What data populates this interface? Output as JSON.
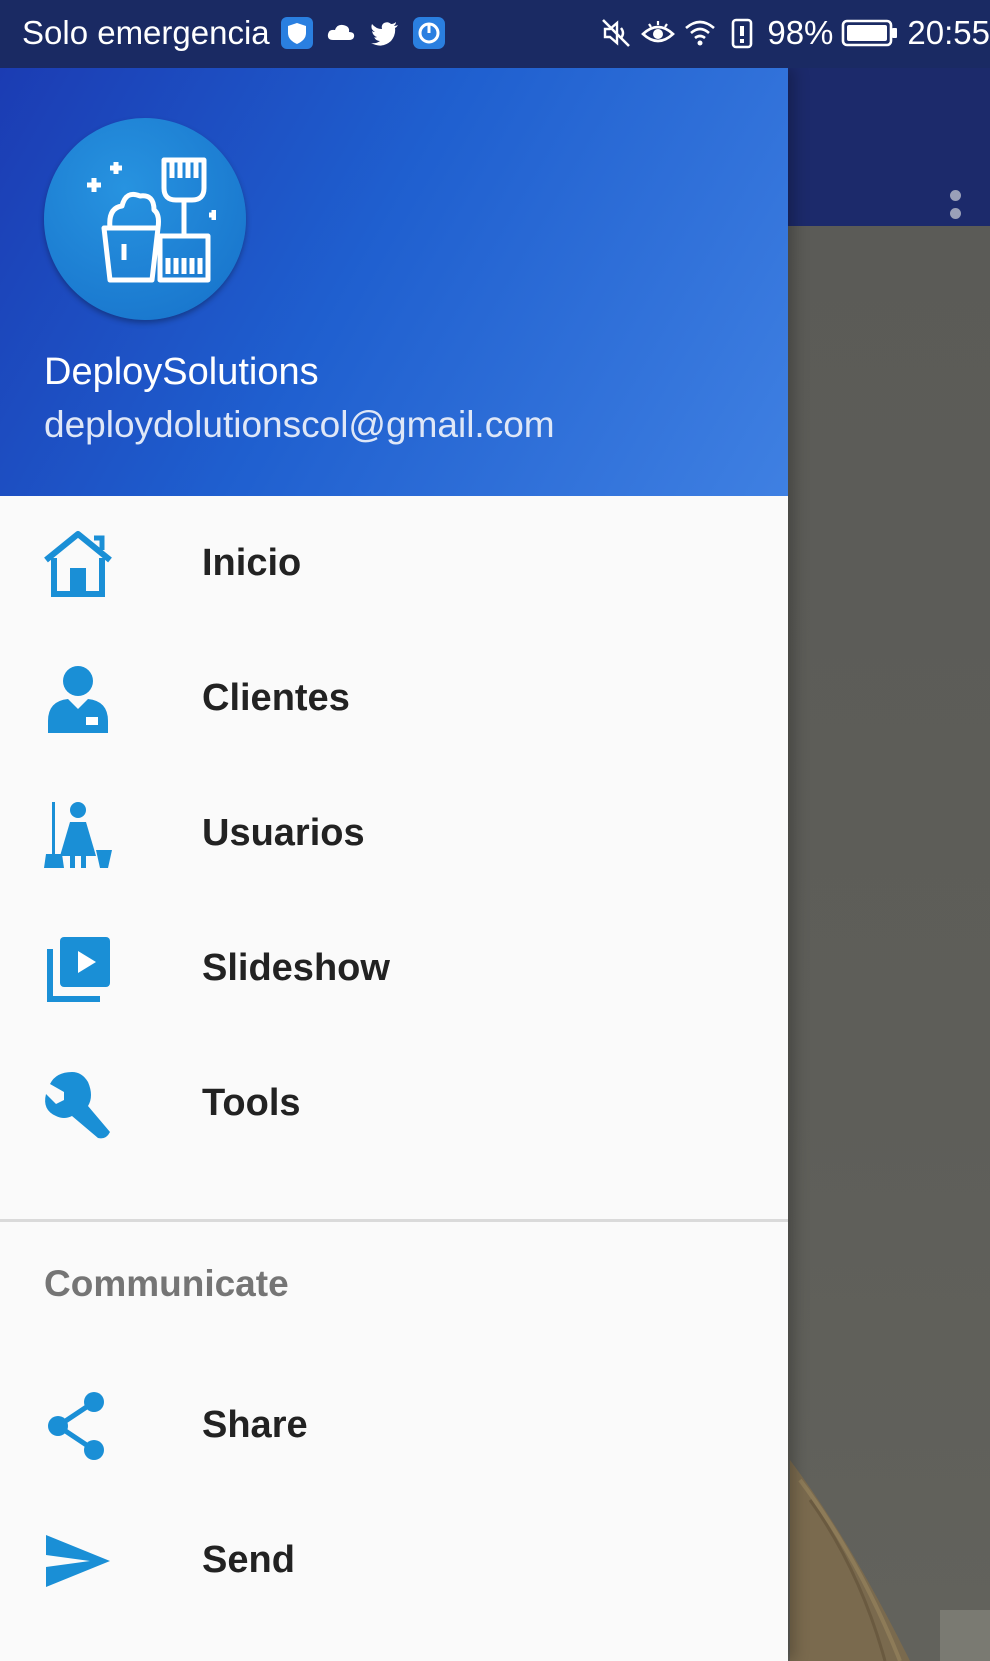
{
  "status_bar": {
    "carrier": "Solo emergencia",
    "battery": "98%",
    "time": "20:55"
  },
  "header": {
    "name": "DeploySolutions",
    "email": "deploydolutionscol@gmail.com"
  },
  "menu": {
    "items": [
      {
        "label": "Inicio",
        "icon": "home-icon"
      },
      {
        "label": "Clientes",
        "icon": "person-icon"
      },
      {
        "label": "Usuarios",
        "icon": "cleaner-icon"
      },
      {
        "label": "Slideshow",
        "icon": "slideshow-icon"
      },
      {
        "label": "Tools",
        "icon": "wrench-icon"
      }
    ]
  },
  "communicate": {
    "title": "Communicate",
    "items": [
      {
        "label": "Share",
        "icon": "share-icon"
      },
      {
        "label": "Send",
        "icon": "send-icon"
      }
    ]
  },
  "colors": {
    "accent": "#1a8fd6",
    "header_start": "#1b3cb3",
    "header_end": "#3f80e2",
    "status_bar": "#1a2a63"
  }
}
